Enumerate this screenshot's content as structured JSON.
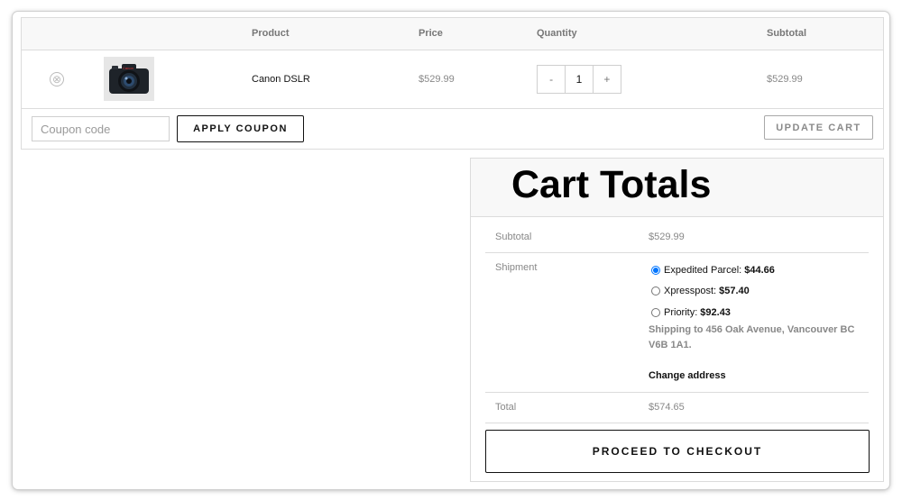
{
  "cart": {
    "columns": {
      "product": "Product",
      "price": "Price",
      "quantity": "Quantity",
      "subtotal": "Subtotal"
    },
    "item": {
      "remove_icon": "⊗",
      "image_icon": "camera-photo-icon",
      "product": "Canon DSLR",
      "price": "$529.99",
      "qty_minus": "-",
      "qty_value": "1",
      "qty_plus": "+",
      "subtotal": "$529.99"
    },
    "coupon_placeholder": "Coupon code",
    "apply_label": "APPLY COUPON",
    "update_label": "UPDATE CART"
  },
  "totals": {
    "title": "Cart Totals",
    "subtotal_label": "Subtotal",
    "subtotal_value": "$529.99",
    "shipment_label": "Shipment",
    "shipping_options": [
      {
        "name": "Expedited Parcel:",
        "price": "$44.66",
        "selected": true
      },
      {
        "name": "Xpresspost:",
        "price": "$57.40",
        "selected": false
      },
      {
        "name": "Priority:",
        "price": "$92.43",
        "selected": false
      }
    ],
    "shipping_note": "Shipping to 456 Oak Avenue, Vancouver BC V6B 1A1.",
    "change_address": "Change address",
    "total_label": "Total",
    "total_value": "$574.65",
    "checkout_label": "PROCEED TO CHECKOUT"
  },
  "colors": {
    "header_bg": "#f8f8f8",
    "border": "#dcdcdc",
    "muted_text": "#888888"
  }
}
